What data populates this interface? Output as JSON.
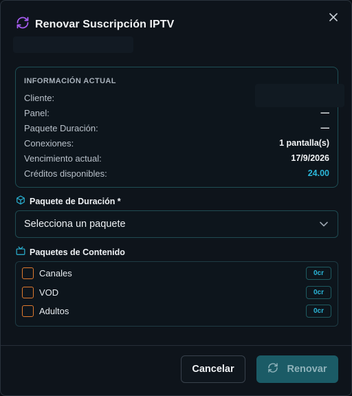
{
  "modal": {
    "title": "Renovar Suscripción IPTV",
    "title_icon": "refresh-icon",
    "close_icon": "close-icon"
  },
  "info": {
    "heading": "INFORMACIÓN ACTUAL",
    "rows": [
      {
        "label": "Cliente:",
        "value": ""
      },
      {
        "label": "Panel:",
        "value": "—"
      },
      {
        "label": "Paquete Duración:",
        "value": "—"
      },
      {
        "label": "Conexiones:",
        "value": "1 pantalla(s)"
      },
      {
        "label": "Vencimiento actual:",
        "value": "17/9/2026"
      },
      {
        "label": "Créditos disponibles:",
        "value": "24.00"
      }
    ]
  },
  "duration": {
    "label": "Paquete de Duración *",
    "icon": "package-icon",
    "select_value": "Selecciona un paquete"
  },
  "content": {
    "label": "Paquetes de Contenido",
    "icon": "tv-icon",
    "packages": [
      {
        "name": "Canales",
        "credits": "0cr"
      },
      {
        "name": "VOD",
        "credits": "0cr"
      },
      {
        "name": "Adultos",
        "credits": "0cr"
      }
    ]
  },
  "footer": {
    "cancel_label": "Cancelar",
    "renew_label": "Renovar"
  },
  "colors": {
    "accent": "#2bb6d8",
    "title_icon": "#a65cf0",
    "checkbox_border": "#e07a2e",
    "renew_button_bg": "#1b5b66"
  }
}
